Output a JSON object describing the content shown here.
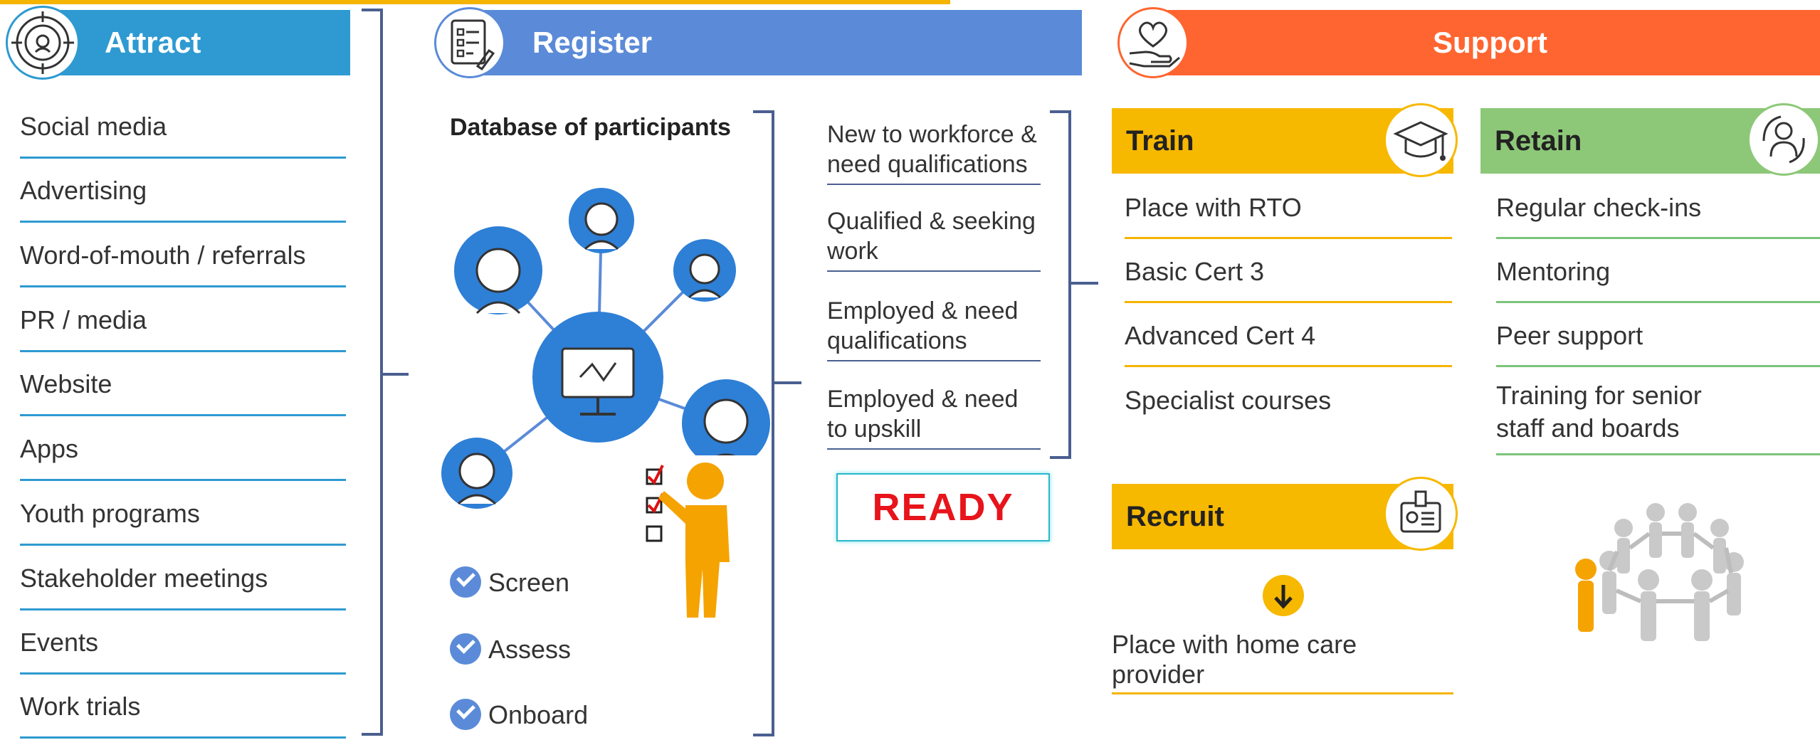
{
  "attract": {
    "title": "Attract",
    "items": [
      "Social media",
      "Advertising",
      "Word-of-mouth / referrals",
      "PR / media",
      "Website",
      "Apps",
      "Youth programs",
      "Stakeholder meetings",
      "Events",
      "Work trials"
    ]
  },
  "register": {
    "title": "Register",
    "database_label": "Database of participants",
    "steps": [
      "Screen",
      "Assess",
      "Onboard"
    ],
    "segments": [
      "New to workforce & need qualifications",
      "Qualified & seeking work",
      "Employed & need qualifications",
      "Employed & need to upskill"
    ],
    "ready_label": "READY"
  },
  "support": {
    "title": "Support",
    "train": {
      "title": "Train",
      "items": [
        "Place with RTO",
        "Basic Cert 3",
        "Advanced Cert 4",
        "Specialist courses"
      ]
    },
    "retain": {
      "title": "Retain",
      "items": [
        "Regular check-ins",
        "Mentoring",
        "Peer support",
        "Training for senior staff and boards"
      ]
    },
    "recruit": {
      "title": "Recruit",
      "item": "Place with home care provider"
    }
  },
  "colors": {
    "attract": "#2e9ad1",
    "register": "#5b8bd8",
    "support": "#ff6530",
    "train": "#f7b800",
    "retain": "#8dc878",
    "ready": "#e8141b"
  }
}
